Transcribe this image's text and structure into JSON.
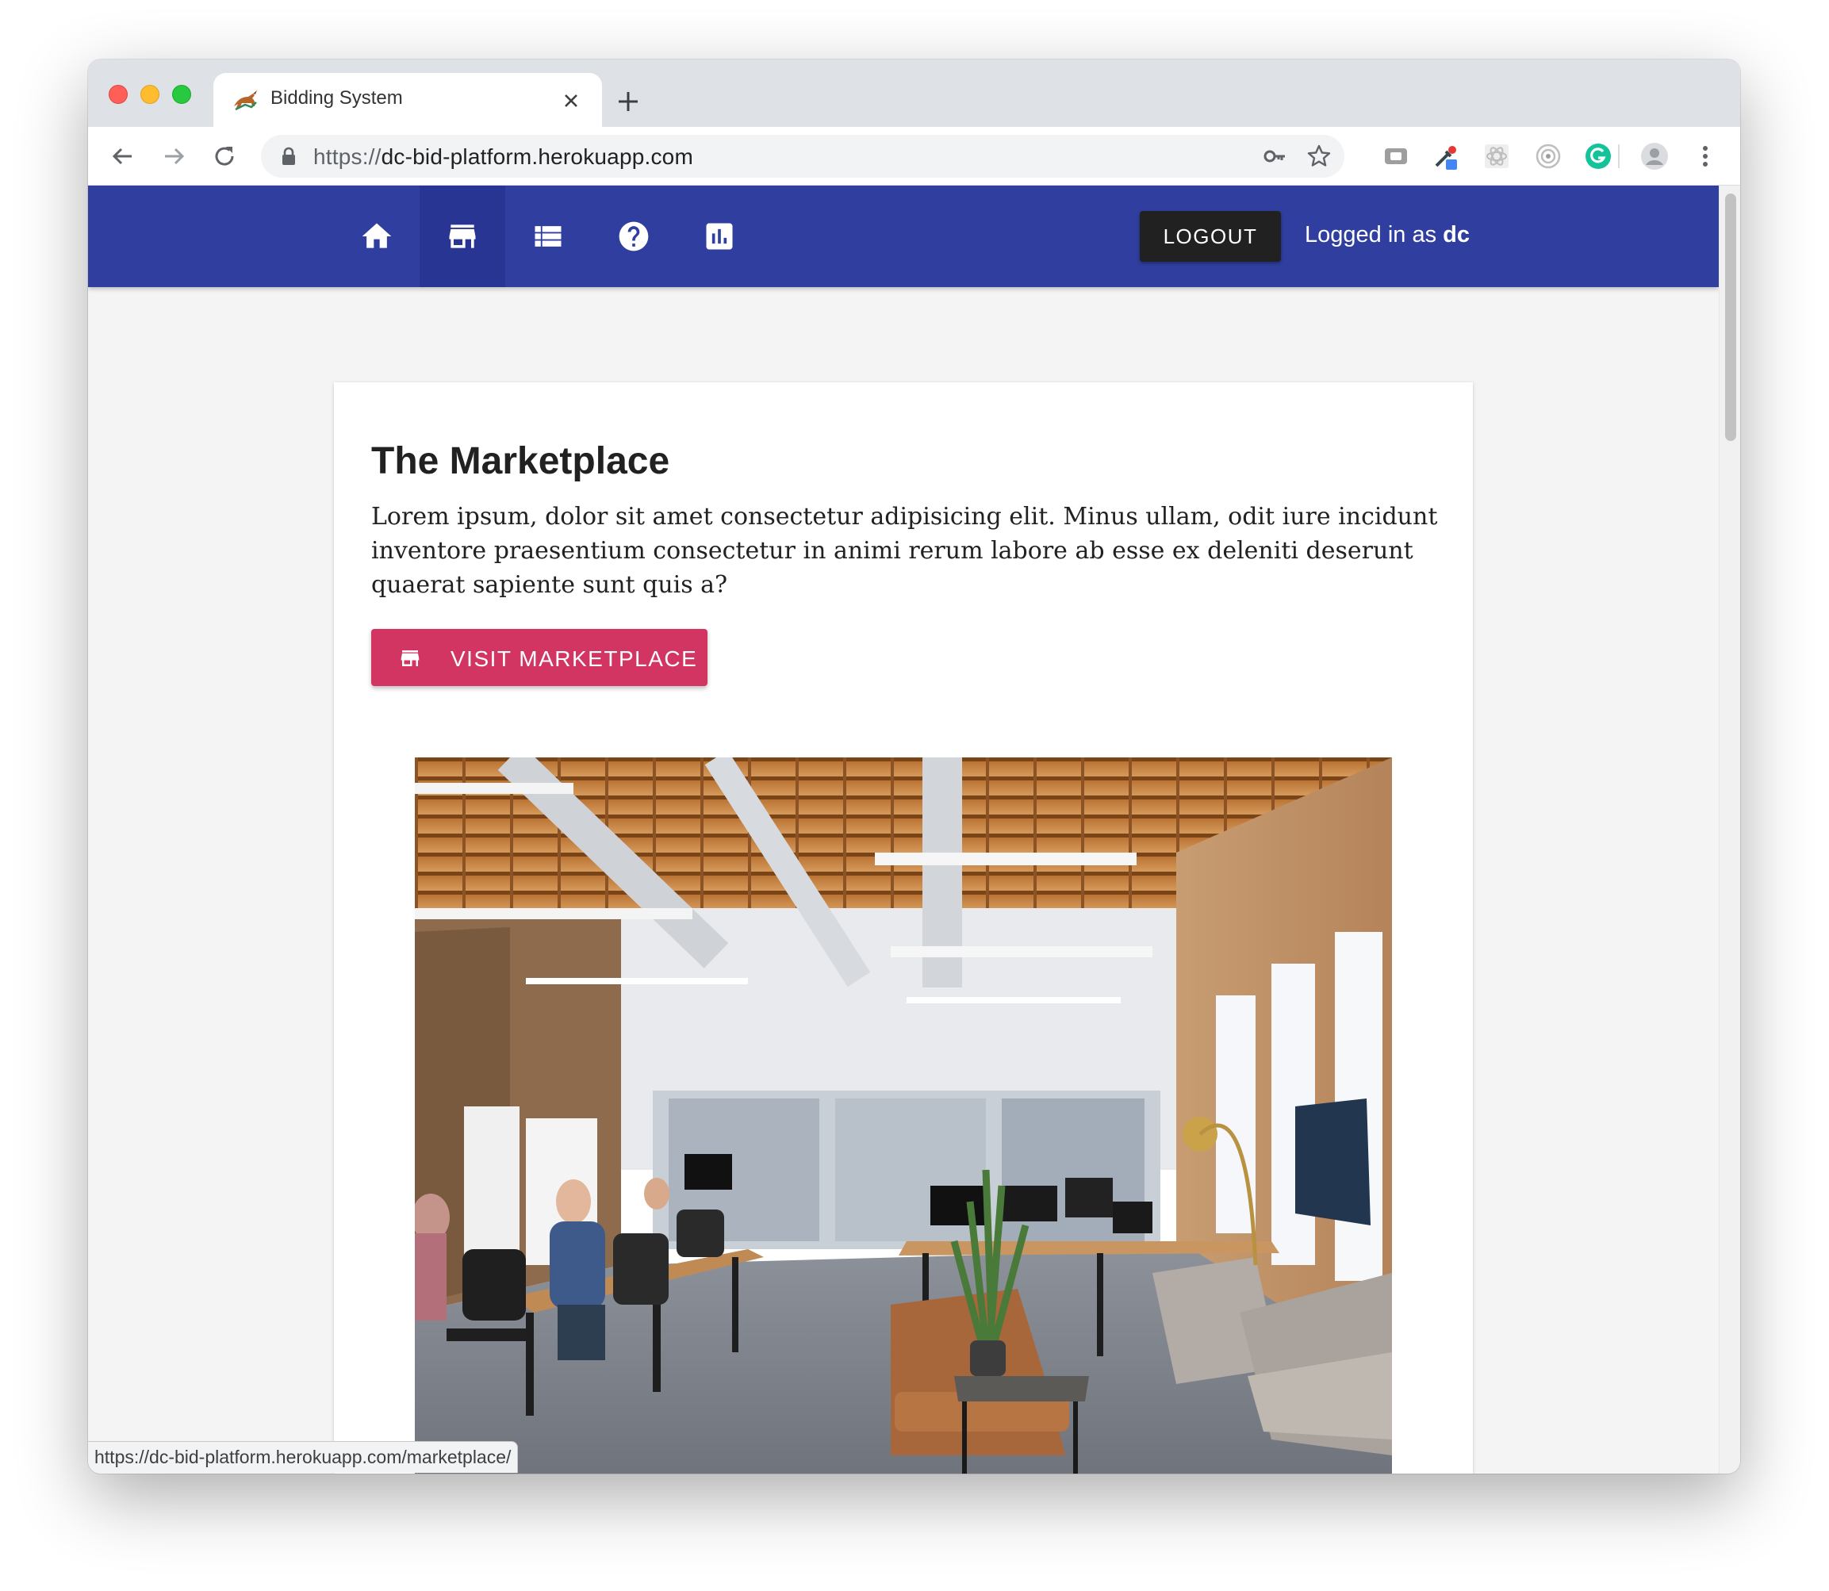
{
  "browser": {
    "tab": {
      "title": "Bidding System",
      "favicon": "bull-favicon-icon"
    },
    "address_bar": {
      "scheme": "https://",
      "host": "dc-bid-platform.herokuapp.com"
    },
    "status_url": "https://dc-bid-platform.herokuapp.com/marketplace/",
    "icons": [
      "back-icon",
      "forward-icon",
      "reload-icon",
      "lock-icon",
      "key-icon",
      "star-icon",
      "extension-icons",
      "profile-icon",
      "menu-icon"
    ]
  },
  "appbar": {
    "background": "#303f9f",
    "active_background": "#283593",
    "nav": [
      {
        "icon": "home-icon",
        "active": false
      },
      {
        "icon": "store-icon",
        "active": true
      },
      {
        "icon": "list-icon",
        "active": false
      },
      {
        "icon": "help-icon",
        "active": false
      },
      {
        "icon": "bar-chart-icon",
        "active": false
      }
    ],
    "logout_label": "LOGOUT",
    "logged_in_prefix": "Logged in as",
    "username": "dc"
  },
  "card": {
    "title": "The Marketplace",
    "body": "Lorem ipsum, dolor sit amet consectetur adipisicing elit. Minus ullam, odit iure incidunt inventore praesentium consectetur in animi rerum labore ab esse ex deleniti deserunt quaerat sapiente sunt quis a?",
    "button_label": "VISIT MARKETPLACE",
    "button_icon": "store-icon",
    "button_color": "#d33563"
  }
}
